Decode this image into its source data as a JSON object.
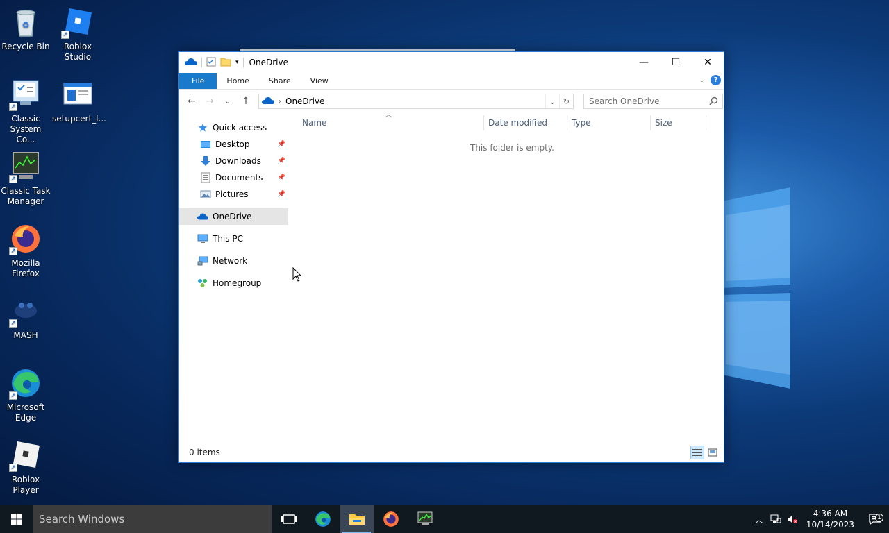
{
  "desktop": {
    "icons": [
      {
        "label": "Recycle Bin",
        "icon": "recycle-bin-icon"
      },
      {
        "label": "Roblox Studio",
        "icon": "roblox-studio-icon"
      },
      {
        "label": "Classic System Co...",
        "icon": "control-panel-icon"
      },
      {
        "label": "setupcert_l...",
        "icon": "setup-file-icon"
      },
      {
        "label": "Classic Task Manager",
        "icon": "task-manager-icon"
      },
      {
        "label": "Mozilla Firefox",
        "icon": "firefox-icon"
      },
      {
        "label": "MASH",
        "icon": "mash-icon"
      },
      {
        "label": "Microsoft Edge",
        "icon": "edge-icon"
      },
      {
        "label": "Roblox Player",
        "icon": "roblox-player-icon"
      }
    ]
  },
  "window": {
    "title": "OneDrive",
    "controls": {
      "minimize": "—",
      "maximize": "☐",
      "close": "✕"
    },
    "ribbon": {
      "tabs": [
        "File",
        "Home",
        "Share",
        "View"
      ],
      "help": "?"
    },
    "address": {
      "crumb": "OneDrive"
    },
    "search": {
      "placeholder": "Search OneDrive"
    },
    "nav_pane": {
      "quick_access": "Quick access",
      "pinned": [
        "Desktop",
        "Downloads",
        "Documents",
        "Pictures"
      ],
      "onedrive": "OneDrive",
      "this_pc": "This PC",
      "network": "Network",
      "homegroup": "Homegroup"
    },
    "columns": [
      "Name",
      "Date modified",
      "Type",
      "Size"
    ],
    "empty_message": "This folder is empty.",
    "status": "0 items"
  },
  "taskbar": {
    "search_placeholder": "Search Windows",
    "time": "4:36 AM",
    "date": "10/14/2023",
    "notification_count": "1"
  },
  "colors": {
    "accent": "#1979ca",
    "selected": "#e5e5e5"
  }
}
